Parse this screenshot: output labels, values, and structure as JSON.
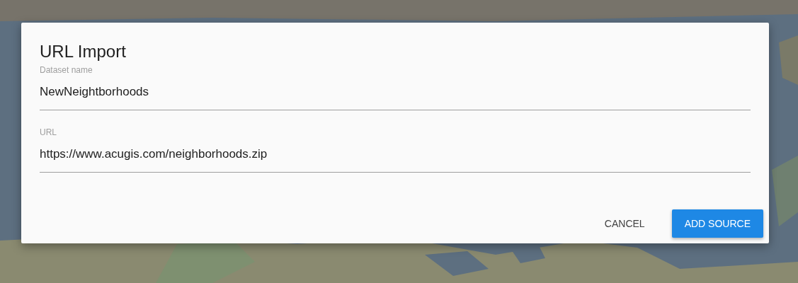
{
  "dialog": {
    "title": "URL Import",
    "fields": [
      {
        "label": "Dataset name",
        "value": "NewNeightborhoods"
      },
      {
        "label": "URL",
        "value": "https://www.acugis.com/neighborhoods.zip"
      }
    ],
    "buttons": [
      {
        "label": "CANCEL",
        "kind": "flat"
      },
      {
        "label": "ADD SOURCE",
        "kind": "raised"
      }
    ]
  }
}
